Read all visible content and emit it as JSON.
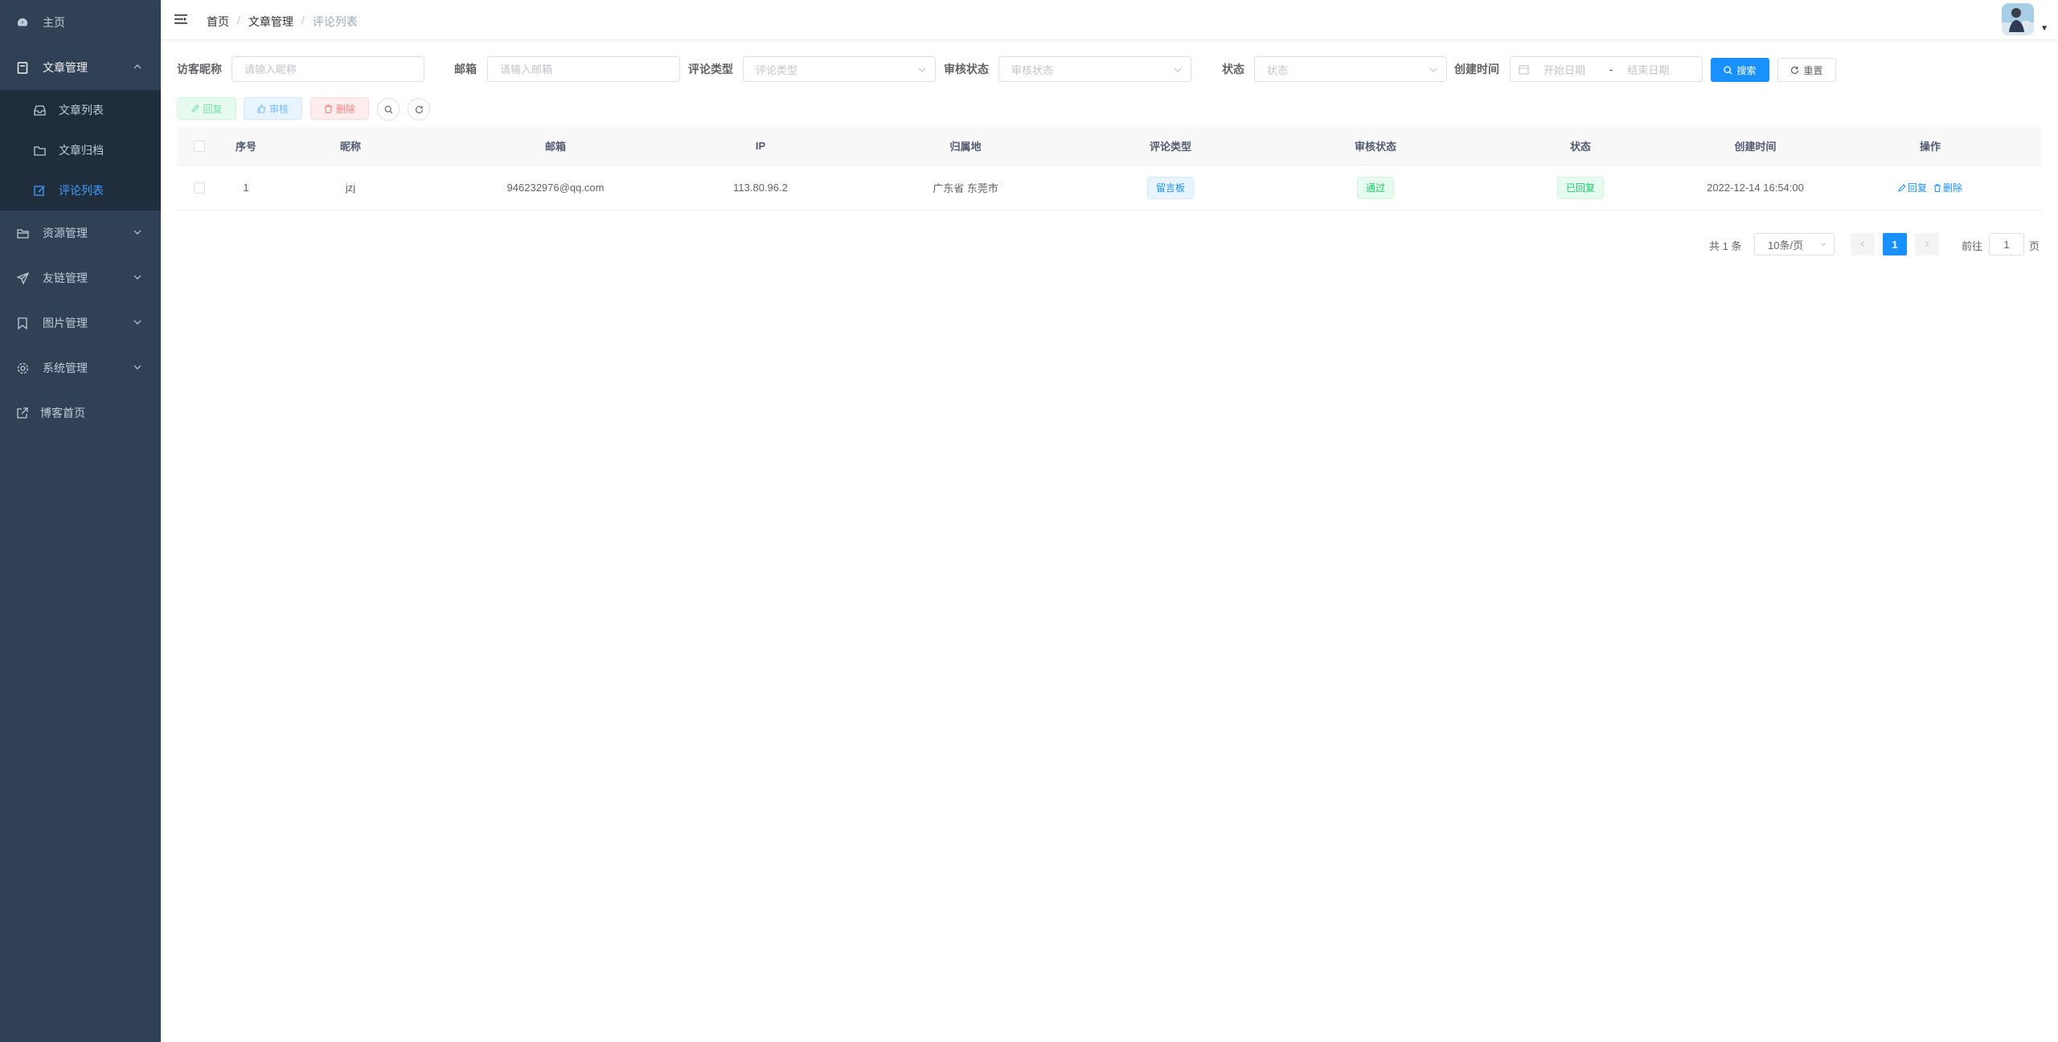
{
  "sidebar": {
    "home": "主页",
    "article_mgmt": "文章管理",
    "article_list": "文章列表",
    "article_archive": "文章归档",
    "comment_list": "评论列表",
    "resource_mgmt": "资源管理",
    "friend_links": "友链管理",
    "image_mgmt": "图片管理",
    "system_mgmt": "系统管理",
    "blog_home": "博客首页"
  },
  "header": {
    "breadcrumb": [
      "首页",
      "文章管理",
      "评论列表"
    ],
    "separator": "/"
  },
  "filters": {
    "nickname_label": "访客昵称",
    "nickname_placeholder": "请输入昵称",
    "email_label": "邮箱",
    "email_placeholder": "请输入邮箱",
    "type_label": "评论类型",
    "type_placeholder": "评论类型",
    "audit_label": "审核状态",
    "audit_placeholder": "审核状态",
    "status_label": "状态",
    "status_placeholder": "状态",
    "created_label": "创建时间",
    "start_placeholder": "开始日期",
    "range_sep": "-",
    "end_placeholder": "结束日期",
    "search_btn": "搜索",
    "reset_btn": "重置"
  },
  "toolbar": {
    "reply": "回复",
    "audit": "审核",
    "delete": "删除"
  },
  "table": {
    "columns": [
      "序号",
      "昵称",
      "邮箱",
      "IP",
      "归属地",
      "评论类型",
      "审核状态",
      "状态",
      "创建时间",
      "操作"
    ],
    "rows": [
      {
        "index": "1",
        "nickname": "jzj",
        "email": "946232976@qq.com",
        "ip": "113.80.96.2",
        "location": "广东省 东莞市",
        "type": "留言板",
        "audit": "通过",
        "status": "已回复",
        "created": "2022-12-14 16:54:00",
        "op_reply": "回复",
        "op_delete": "删除"
      }
    ]
  },
  "pagination": {
    "total": "共 1 条",
    "page_size": "10条/页",
    "current": "1",
    "goto": "前往",
    "goto_value": "1",
    "page_unit": "页"
  },
  "colors": {
    "sidebar_bg": "#304156",
    "submenu_bg": "#1f2d3d",
    "primary": "#1890ff",
    "success": "#13ce66",
    "danger": "#ff4949"
  }
}
